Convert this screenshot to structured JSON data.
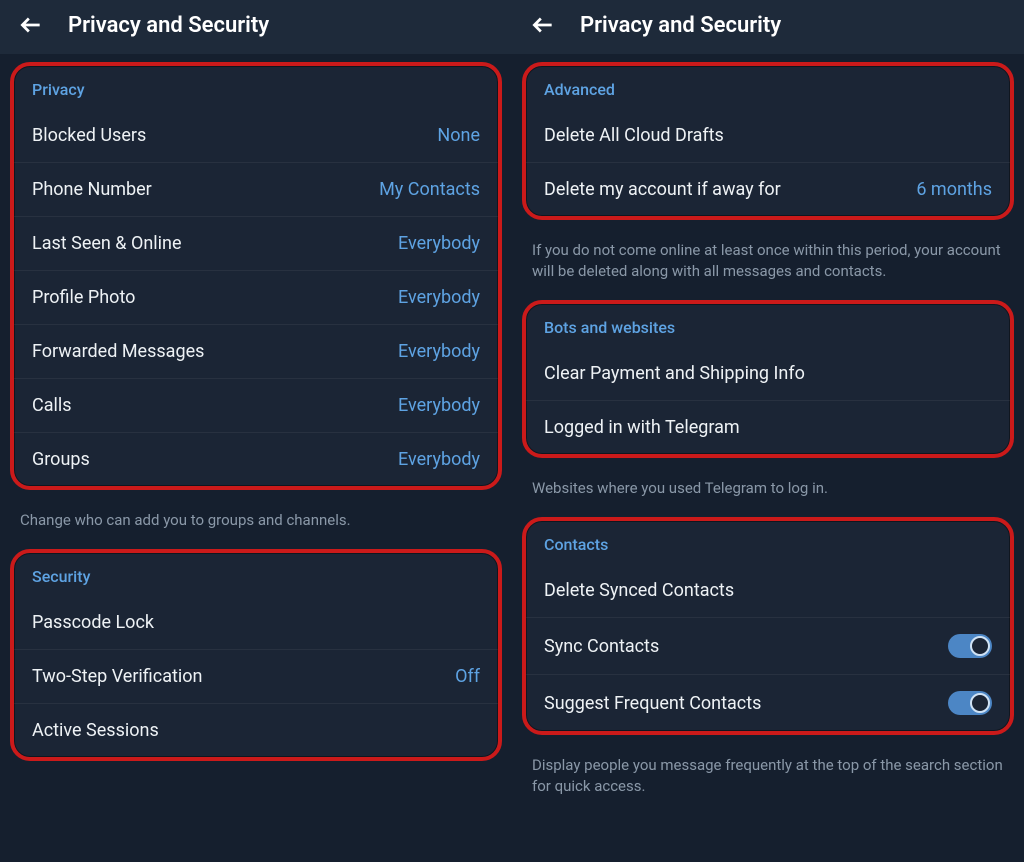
{
  "left": {
    "header": {
      "title": "Privacy and Security"
    },
    "sections": {
      "privacy": {
        "title": "Privacy",
        "blocked_users": {
          "label": "Blocked Users",
          "value": "None"
        },
        "phone_number": {
          "label": "Phone Number",
          "value": "My Contacts"
        },
        "last_seen": {
          "label": "Last Seen & Online",
          "value": "Everybody"
        },
        "profile_photo": {
          "label": "Profile Photo",
          "value": "Everybody"
        },
        "forwarded": {
          "label": "Forwarded Messages",
          "value": "Everybody"
        },
        "calls": {
          "label": "Calls",
          "value": "Everybody"
        },
        "groups": {
          "label": "Groups",
          "value": "Everybody"
        },
        "footer": "Change who can add you to groups and channels."
      },
      "security": {
        "title": "Security",
        "passcode": {
          "label": "Passcode Lock",
          "value": ""
        },
        "two_step": {
          "label": "Two-Step Verification",
          "value": "Off"
        },
        "active_sessions": {
          "label": "Active Sessions",
          "value": ""
        }
      }
    }
  },
  "right": {
    "header": {
      "title": "Privacy and Security"
    },
    "sections": {
      "advanced": {
        "title": "Advanced",
        "delete_drafts": {
          "label": "Delete All Cloud Drafts",
          "value": ""
        },
        "delete_account": {
          "label": "Delete my account if away for",
          "value": "6 months"
        },
        "footer": "If you do not come online at least once within this period, your account will be deleted along with all messages and contacts."
      },
      "bots": {
        "title": "Bots and websites",
        "clear_payment": {
          "label": "Clear Payment and Shipping Info",
          "value": ""
        },
        "logged_in": {
          "label": "Logged in with Telegram",
          "value": ""
        },
        "footer": "Websites where you used Telegram to log in."
      },
      "contacts": {
        "title": "Contacts",
        "delete_synced": {
          "label": "Delete Synced Contacts"
        },
        "sync": {
          "label": "Sync Contacts",
          "on": true
        },
        "suggest": {
          "label": "Suggest Frequent Contacts",
          "on": true
        },
        "footer": "Display people you message frequently at the top of the search section for quick access."
      }
    }
  }
}
